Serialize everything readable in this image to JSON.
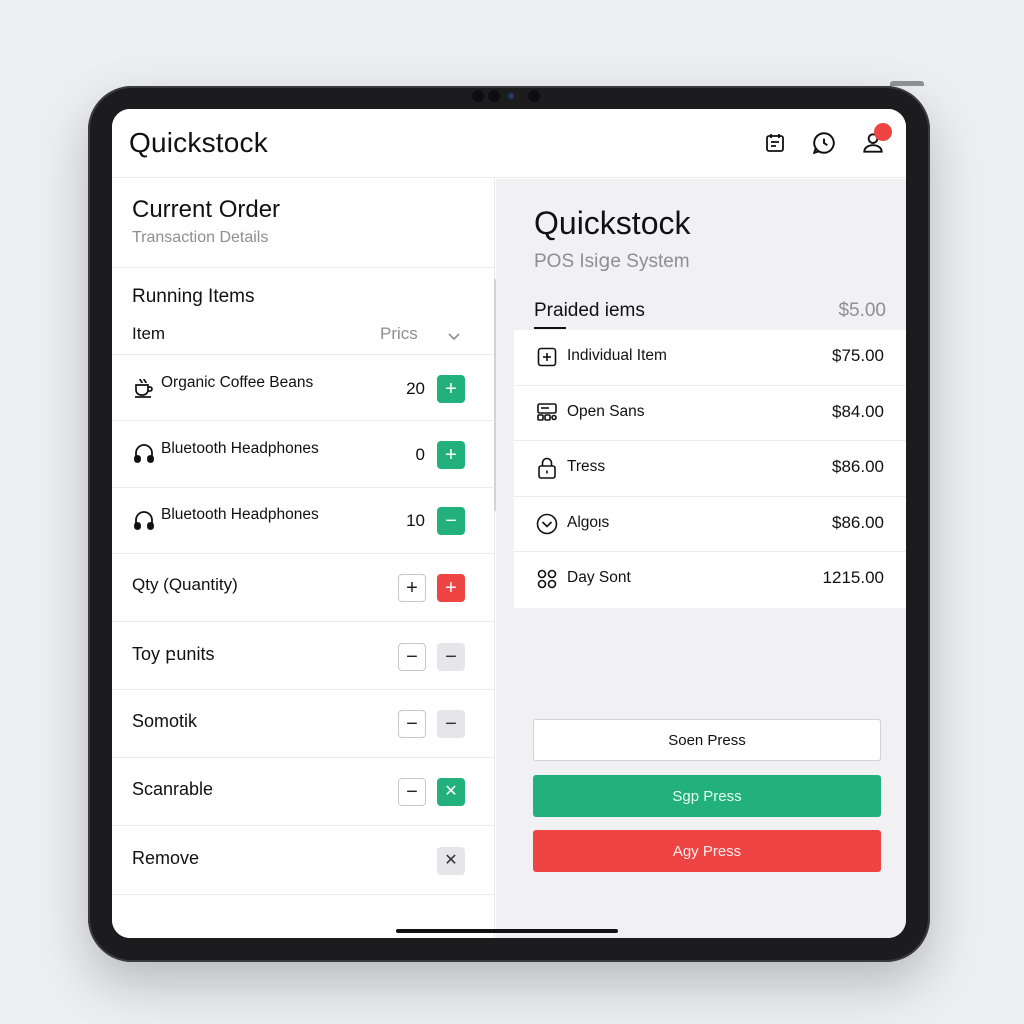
{
  "app": {
    "title": "Quickstock"
  },
  "header": {
    "icons": [
      "calendar-icon",
      "clock-icon",
      "user-icon"
    ],
    "notification_color": "#ef4444"
  },
  "left": {
    "title": "Current Order",
    "subtitle": "Transaction Details",
    "section": "Running Items",
    "columns": {
      "item": "Item",
      "price": "Prics"
    },
    "products": [
      {
        "icon": "coffee-cup-icon",
        "name": "Organic Coffee Beans",
        "qty": "20",
        "action": "+"
      },
      {
        "icon": "headphones-icon",
        "name": "Bluetooth Headphones",
        "qty": "0",
        "action": "+"
      },
      {
        "icon": "headphones-icon",
        "name": "Bluetooth Headphones",
        "qty": "10",
        "action": "−"
      }
    ],
    "controls": [
      {
        "label": "Qty (Quantity)",
        "btn1": "+",
        "btn2": "+"
      },
      {
        "label": "Toy բunits",
        "btn1": "−",
        "btn2": "−"
      },
      {
        "label": "Somotik",
        "btn1": "−",
        "btn2": "−"
      },
      {
        "label": "Scanrable",
        "btn1": "−",
        "btn2": "✕"
      },
      {
        "label": "Remove",
        "btn2": "✕"
      }
    ]
  },
  "right": {
    "title": "Quickstock",
    "subtitle": "POS Isiցe System",
    "section": "Praided iems",
    "total": "$5.00",
    "items": [
      {
        "icon": "plus-square-icon",
        "name": "Individual Item",
        "price": "$75.00"
      },
      {
        "icon": "register-icon",
        "name": "Open Sans",
        "price": "$84.00"
      },
      {
        "icon": "lock-icon",
        "name": "Tress",
        "price": "$86.00"
      },
      {
        "icon": "chevron-circle-icon",
        "name": "Algoᴉs",
        "price": "$86.00"
      },
      {
        "icon": "grid-icon",
        "name": "Day Sont",
        "price": "1215.00"
      }
    ],
    "buttons": {
      "primary_outline": "Soen Press",
      "confirm": "Sgp Press",
      "danger": "Agy Press"
    }
  },
  "colors": {
    "accent_green": "#22b07d",
    "danger_red": "#ef4444",
    "muted_text": "#8e8e93"
  }
}
